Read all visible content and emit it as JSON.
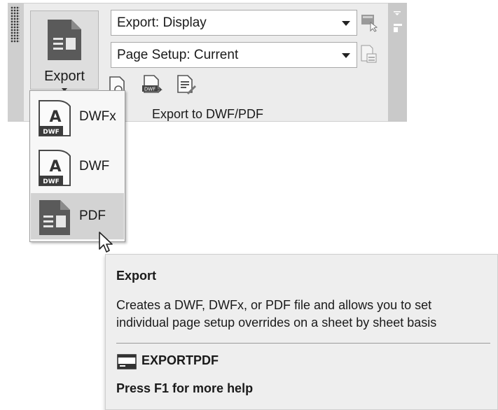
{
  "ribbon": {
    "export_button_label": "Export",
    "combo_export": "Export: Display",
    "combo_page_setup": "Page Setup: Current",
    "panel_title": "Export to DWF/PDF"
  },
  "dropdown": {
    "items": [
      {
        "label": "DWFx",
        "icon": "dwfx-file-icon",
        "badge": "DWF",
        "letter": "A"
      },
      {
        "label": "DWF",
        "icon": "dwf-file-icon",
        "badge": "DWF",
        "letter": "A"
      },
      {
        "label": "PDF",
        "icon": "pdf-file-icon"
      }
    ],
    "hovered": "PDF"
  },
  "tooltip": {
    "title": "Export",
    "description": "Creates a DWF, DWFx, or PDF file and allows you to set individual page setup overrides on a sheet by sheet basis",
    "command": "EXPORTPDF",
    "help": "Press F1 for more help"
  }
}
